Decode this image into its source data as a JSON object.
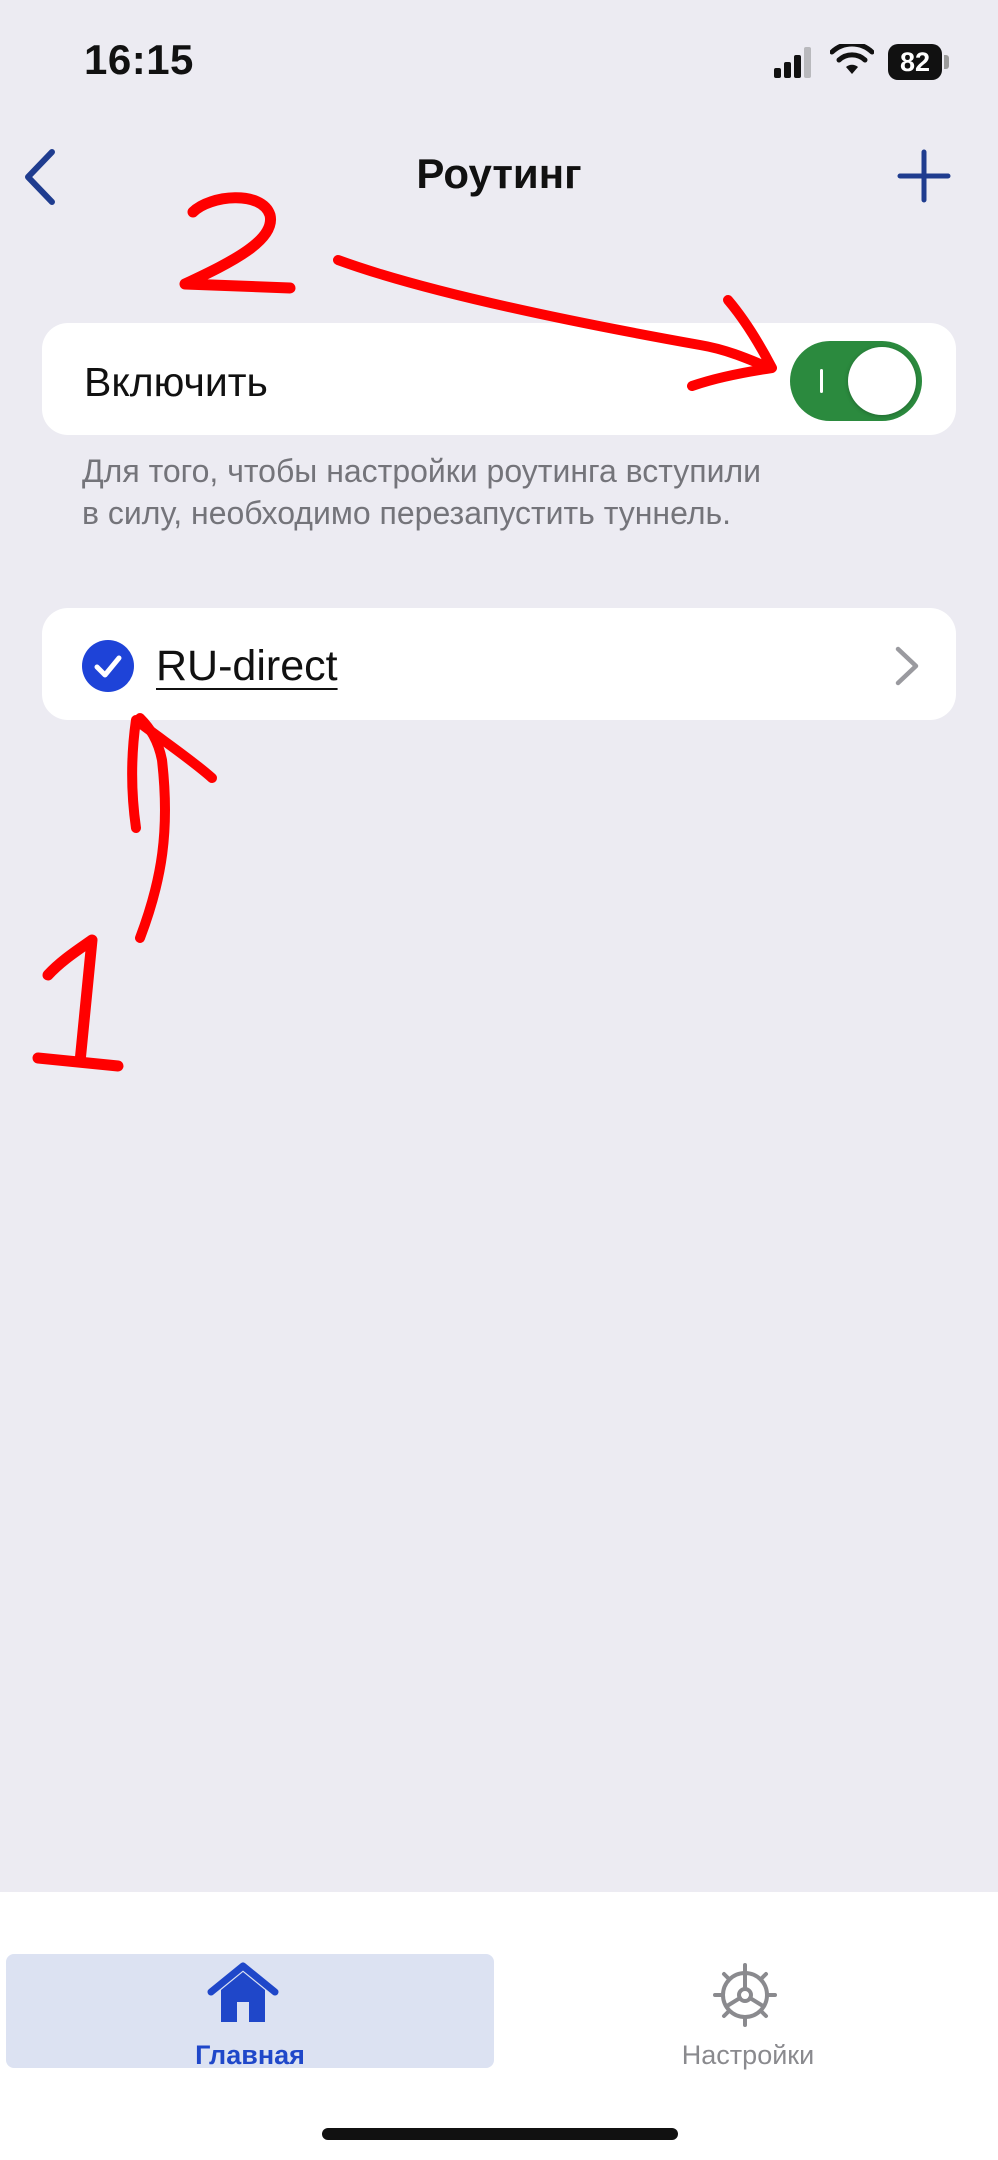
{
  "status_bar": {
    "time": "16:15",
    "battery": "82"
  },
  "nav": {
    "title": "Роутинг"
  },
  "routing": {
    "enable_label": "Включить",
    "enabled": true,
    "hint": "Для того, чтобы настройки роутинга вступили\nв силу, необходимо перезапустить туннель.",
    "profile": {
      "name": "RU-direct",
      "selected": true
    }
  },
  "annotations": {
    "one": "1",
    "two": "2"
  },
  "tabs": [
    {
      "label": "Главная",
      "icon": "home-icon",
      "active": true
    },
    {
      "label": "Настройки",
      "icon": "gear-icon",
      "active": false
    }
  ],
  "colors": {
    "background": "#ECEBF2",
    "accent": "#1E43D8",
    "toggle_on": "#2B8A3E",
    "annotation": "#FF0000"
  }
}
